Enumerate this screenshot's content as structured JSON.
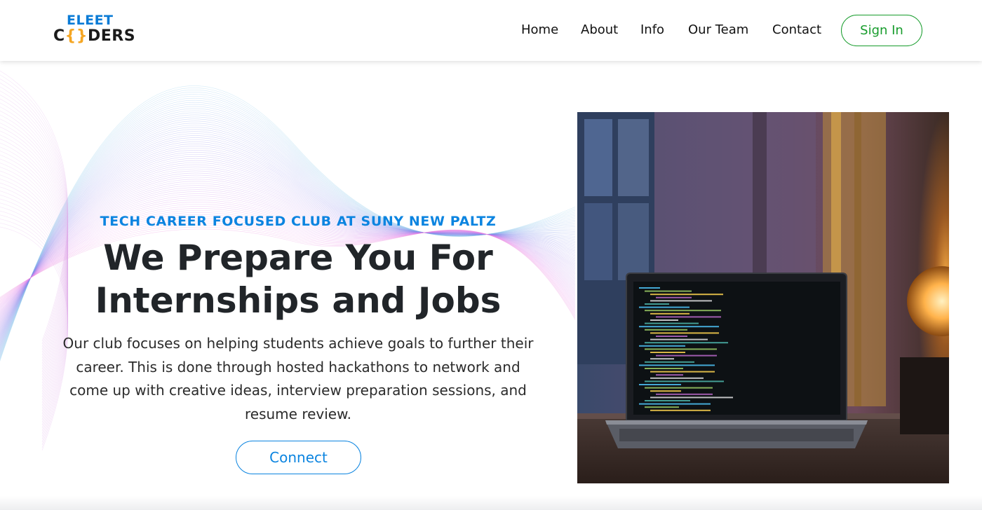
{
  "brand": {
    "logo_top": "ELEET",
    "logo_bottom_pre": "C",
    "logo_bottom_brace": "{}",
    "logo_bottom_post": "DERS"
  },
  "nav": {
    "items": [
      {
        "label": "Home"
      },
      {
        "label": "About"
      },
      {
        "label": "Info"
      },
      {
        "label": "Our Team"
      },
      {
        "label": "Contact"
      }
    ],
    "signin_label": "Sign In"
  },
  "hero": {
    "eyebrow": "TECH CAREER FOCUSED CLUB AT SUNY NEW PALTZ",
    "headline_line1": "We Prepare You For",
    "headline_line2": "Internships and Jobs",
    "description": "Our club focuses on helping students achieve goals to further their career. This is done through hosted hackathons to network and come up with creative ideas, interview preparation sessions, and resume review.",
    "connect_label": "Connect"
  },
  "colors": {
    "brand_blue": "#0b84e0",
    "signin_green": "#179c2c",
    "logo_accent": "#f5a623"
  }
}
